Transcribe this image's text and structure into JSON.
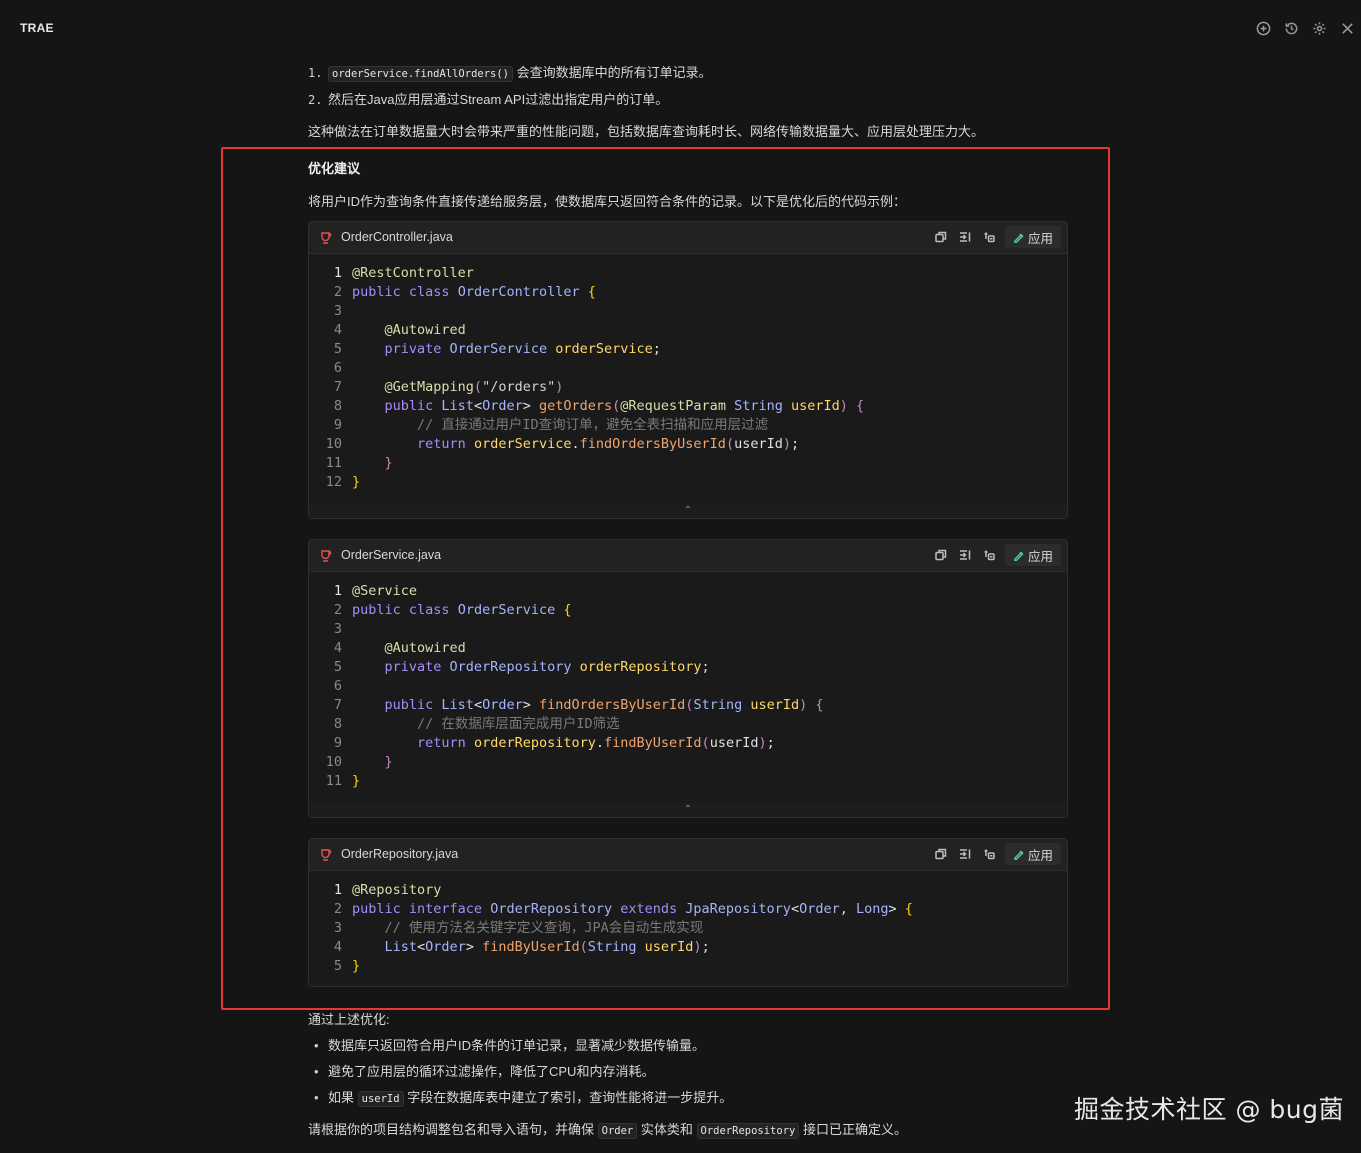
{
  "app": {
    "title": "TRAE"
  },
  "top_icons": [
    "add-chat-icon",
    "history-icon",
    "settings-icon",
    "close-icon"
  ],
  "intro": {
    "step1_num": "1.",
    "step1_code": "orderService.findAllOrders()",
    "step1_text": "会查询数据库中的所有订单记录。",
    "step2_num": "2.",
    "step2_text": "然后在Java应用层通过Stream API过滤出指定用户的订单。",
    "summary": "这种做法在订单数据量大时会带来严重的性能问题，包括数据库查询耗时长、网络传输数据量大、应用层处理压力大。"
  },
  "optimization": {
    "heading": "优化建议",
    "desc": "将用户ID作为查询条件直接传递给服务层，使数据库只返回符合条件的记录。以下是优化后的代码示例："
  },
  "code_blocks": [
    {
      "file": "OrderController.java",
      "apply_label": "应用",
      "lines": [
        [
          [
            "ann",
            "@RestController"
          ]
        ],
        [
          [
            "kw2",
            "public "
          ],
          [
            "kw2",
            "class "
          ],
          [
            "type",
            "OrderController "
          ],
          [
            "brace",
            "{"
          ]
        ],
        [],
        [
          [
            "plain",
            "    "
          ],
          [
            "ann",
            "@Autowired"
          ]
        ],
        [
          [
            "plain",
            "    "
          ],
          [
            "kw2",
            "private "
          ],
          [
            "type",
            "OrderService "
          ],
          [
            "var",
            "orderService"
          ],
          [
            "plain",
            ";"
          ]
        ],
        [],
        [
          [
            "plain",
            "    "
          ],
          [
            "ann",
            "@GetMapping"
          ],
          [
            "paren",
            "("
          ],
          [
            "str",
            "\"/orders\""
          ],
          [
            "paren",
            ")"
          ]
        ],
        [
          [
            "plain",
            "    "
          ],
          [
            "kw2",
            "public "
          ],
          [
            "type",
            "List"
          ],
          [
            "plain",
            "<"
          ],
          [
            "type",
            "Order"
          ],
          [
            "plain",
            "> "
          ],
          [
            "fn",
            "getOrders"
          ],
          [
            "paren",
            "("
          ],
          [
            "ann",
            "@RequestParam "
          ],
          [
            "type",
            "String "
          ],
          [
            "var",
            "userId"
          ],
          [
            "paren",
            ") "
          ],
          [
            "paren",
            "{"
          ]
        ],
        [
          [
            "plain",
            "        "
          ],
          [
            "cm",
            "// 直接通过用户ID查询订单，避免全表扫描和应用层过滤"
          ]
        ],
        [
          [
            "plain",
            "        "
          ],
          [
            "kw2",
            "return "
          ],
          [
            "var",
            "orderService"
          ],
          [
            "plain",
            "."
          ],
          [
            "fn",
            "findOrdersByUserId"
          ],
          [
            "paren",
            "("
          ],
          [
            "plain",
            "userId"
          ],
          [
            "paren",
            ")"
          ],
          [
            "plain",
            ";"
          ]
        ],
        [
          [
            "plain",
            "    "
          ],
          [
            "paren",
            "}"
          ]
        ],
        [
          [
            "brace",
            "}"
          ]
        ]
      ]
    },
    {
      "file": "OrderService.java",
      "apply_label": "应用",
      "lines": [
        [
          [
            "ann",
            "@Service"
          ]
        ],
        [
          [
            "kw2",
            "public "
          ],
          [
            "kw2",
            "class "
          ],
          [
            "type",
            "OrderService "
          ],
          [
            "brace",
            "{"
          ]
        ],
        [],
        [
          [
            "plain",
            "    "
          ],
          [
            "ann",
            "@Autowired"
          ]
        ],
        [
          [
            "plain",
            "    "
          ],
          [
            "kw2",
            "private "
          ],
          [
            "type",
            "OrderRepository "
          ],
          [
            "var",
            "orderRepository"
          ],
          [
            "plain",
            ";"
          ]
        ],
        [],
        [
          [
            "plain",
            "    "
          ],
          [
            "kw2",
            "public "
          ],
          [
            "type",
            "List"
          ],
          [
            "plain",
            "<"
          ],
          [
            "type",
            "Order"
          ],
          [
            "plain",
            "> "
          ],
          [
            "fn",
            "findOrdersByUserId"
          ],
          [
            "paren",
            "("
          ],
          [
            "type",
            "String "
          ],
          [
            "var",
            "userId"
          ],
          [
            "paren",
            ") "
          ],
          [
            "paren",
            "{"
          ]
        ],
        [
          [
            "plain",
            "        "
          ],
          [
            "cm",
            "// 在数据库层面完成用户ID筛选"
          ]
        ],
        [
          [
            "plain",
            "        "
          ],
          [
            "kw2",
            "return "
          ],
          [
            "var",
            "orderRepository"
          ],
          [
            "plain",
            "."
          ],
          [
            "fn",
            "findByUserId"
          ],
          [
            "paren",
            "("
          ],
          [
            "plain",
            "userId"
          ],
          [
            "paren",
            ")"
          ],
          [
            "plain",
            ";"
          ]
        ],
        [
          [
            "plain",
            "    "
          ],
          [
            "paren",
            "}"
          ]
        ],
        [
          [
            "brace",
            "}"
          ]
        ]
      ]
    },
    {
      "file": "OrderRepository.java",
      "apply_label": "应用",
      "lines": [
        [
          [
            "ann",
            "@Repository"
          ]
        ],
        [
          [
            "kw2",
            "public "
          ],
          [
            "kw2",
            "interface "
          ],
          [
            "type",
            "OrderRepository "
          ],
          [
            "kw2",
            "extends "
          ],
          [
            "type",
            "JpaRepository"
          ],
          [
            "plain",
            "<"
          ],
          [
            "type",
            "Order"
          ],
          [
            "plain",
            ", "
          ],
          [
            "type",
            "Long"
          ],
          [
            "plain",
            "> "
          ],
          [
            "brace",
            "{"
          ]
        ],
        [
          [
            "plain",
            "    "
          ],
          [
            "cm",
            "// 使用方法名关键字定义查询，JPA会自动生成实现"
          ]
        ],
        [
          [
            "plain",
            "    "
          ],
          [
            "type",
            "List"
          ],
          [
            "plain",
            "<"
          ],
          [
            "type",
            "Order"
          ],
          [
            "plain",
            "> "
          ],
          [
            "fn",
            "findByUserId"
          ],
          [
            "paren",
            "("
          ],
          [
            "type",
            "String "
          ],
          [
            "var",
            "userId"
          ],
          [
            "paren",
            ")"
          ],
          [
            "plain",
            ";"
          ]
        ],
        [
          [
            "brace",
            "}"
          ]
        ]
      ]
    }
  ],
  "outro": {
    "lead": "通过上述优化:",
    "bullet1": "数据库只返回符合用户ID条件的订单记录，显著减少数据传输量。",
    "bullet2": "避免了应用层的循环过滤操作，降低了CPU和内存消耗。",
    "bullet3_pre": "如果",
    "bullet3_code": "userId",
    "bullet3_post": "字段在数据库表中建立了索引，查询性能将进一步提升。",
    "final_pre": "请根据你的项目结构调整包名和导入语句，并确保",
    "final_code1": "Order",
    "final_mid": "实体类和",
    "final_code2": "OrderRepository",
    "final_post": "接口已正确定义。"
  },
  "watermark": "掘金技术社区 @ bug菌",
  "colors": {
    "background": "#151515",
    "highlight": "#e53935",
    "annotation": "#dcdcaa",
    "keyword": "#a78bfa",
    "function": "#f0a46d"
  }
}
